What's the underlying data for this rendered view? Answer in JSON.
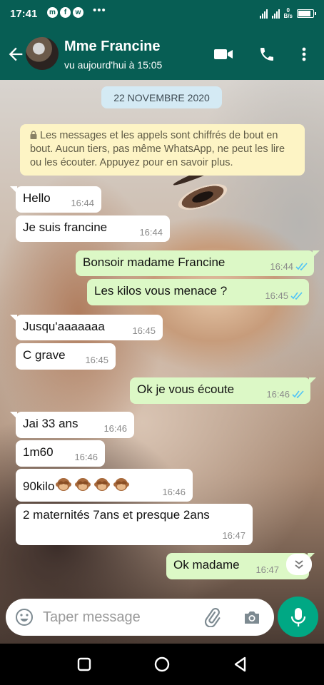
{
  "status_bar": {
    "time": "17:41",
    "app_icons": [
      "messenger-icon",
      "facebook-icon",
      "whatsapp-icon"
    ],
    "net_speed_value": "0",
    "net_speed_unit": "B/s",
    "battery_level_percent": 90
  },
  "header": {
    "contact_name": "Mme Francine",
    "last_seen": "vu aujourd'hui à 15:05"
  },
  "chat": {
    "date_chip": "22 NOVEMBRE 2020",
    "encryption_notice": "Les messages et les appels sont chiffrés de bout en bout. Aucun tiers, pas même WhatsApp, ne peut les lire ou les écouter. Appuyez pour en savoir plus.",
    "messages": [
      {
        "direction": "in",
        "text": "Hello",
        "time": "16:44"
      },
      {
        "direction": "in",
        "text": "Je suis francine",
        "time": "16:44"
      },
      {
        "direction": "out",
        "text": "Bonsoir madame Francine",
        "time": "16:44",
        "status": "read"
      },
      {
        "direction": "out",
        "text": "Les kilos vous menace ?",
        "time": "16:45",
        "status": "read"
      },
      {
        "direction": "in",
        "text": "Jusqu'aaaaaaa",
        "time": "16:45"
      },
      {
        "direction": "in",
        "text": "C grave",
        "time": "16:45"
      },
      {
        "direction": "out",
        "text": "Ok je vous écoute",
        "time": "16:46",
        "status": "read"
      },
      {
        "direction": "in",
        "text": "Jai 33 ans",
        "time": "16:46"
      },
      {
        "direction": "in",
        "text": "1m60",
        "time": "16:46"
      },
      {
        "direction": "in",
        "text": "90kilo",
        "emoji": "🙈🙈🙈🙈",
        "time": "16:46"
      },
      {
        "direction": "in",
        "text": "2 maternités 7ans et presque 2ans",
        "time": "16:47"
      },
      {
        "direction": "out",
        "text": "Ok madame",
        "time": "16:47",
        "status": "read"
      }
    ]
  },
  "input": {
    "placeholder": "Taper message"
  },
  "colors": {
    "header": "#075e54",
    "outgoing_bubble": "#dcf8c6",
    "incoming_bubble": "#ffffff",
    "read_ticks": "#4fc3f7",
    "mic_button": "#00a884",
    "notice_bg": "#fdf4c5",
    "date_chip_bg": "#d4eaf4"
  }
}
